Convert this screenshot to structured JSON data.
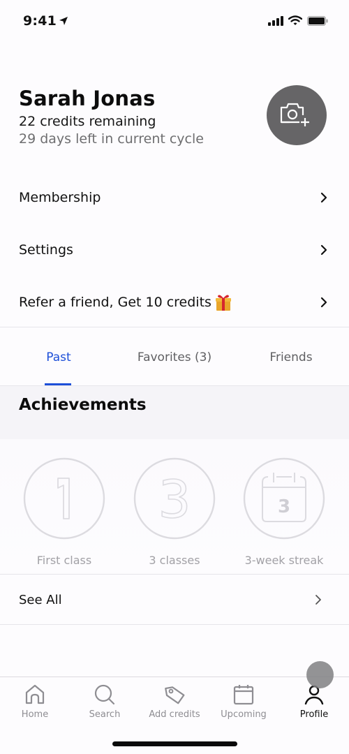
{
  "status_bar": {
    "time": "9:41",
    "icons": [
      "location-arrow-icon",
      "cellular-signal-icon",
      "wifi-icon",
      "battery-icon"
    ]
  },
  "profile": {
    "name": "Sarah Jonas",
    "credits_text": "22 credits remaining",
    "cycle_text": "29 days left in current cycle",
    "avatar_icon": "camera-add-icon",
    "avatar_bg": "#666567"
  },
  "menu": {
    "items": [
      {
        "label": "Membership",
        "icon": "chevron-right-icon"
      },
      {
        "label": "Settings",
        "icon": "chevron-right-icon"
      },
      {
        "label": "Refer a friend, Get 10 credits",
        "emoji": "🎁",
        "icon": "chevron-right-icon"
      }
    ]
  },
  "tabs": {
    "items": [
      {
        "label": "Past",
        "active": true
      },
      {
        "label": "Favorites (3)",
        "active": false
      },
      {
        "label": "Friends",
        "active": false
      }
    ],
    "accent_color": "#1d4fd8"
  },
  "achievements": {
    "title": "Achievements",
    "badges": [
      {
        "label": "First class",
        "icon": "number-1-badge-icon",
        "glyph": "1"
      },
      {
        "label": "3 classes",
        "icon": "number-3-badge-icon",
        "glyph": "3"
      },
      {
        "label": "3-week streak",
        "icon": "calendar-3-badge-icon",
        "glyph": "3"
      }
    ],
    "see_all_label": "See All"
  },
  "tab_bar": {
    "items": [
      {
        "label": "Home",
        "icon": "home-icon",
        "active": false
      },
      {
        "label": "Search",
        "icon": "search-icon",
        "active": false
      },
      {
        "label": "Add credits",
        "icon": "tag-icon",
        "active": false
      },
      {
        "label": "Upcoming",
        "icon": "calendar-icon",
        "active": false
      },
      {
        "label": "Profile",
        "icon": "profile-icon",
        "active": true
      }
    ]
  }
}
